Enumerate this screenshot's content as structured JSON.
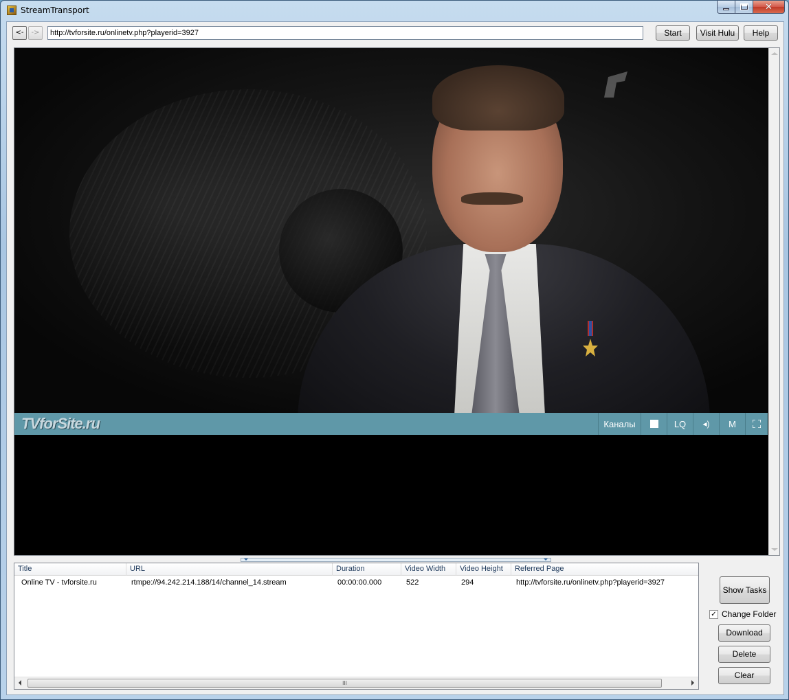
{
  "window": {
    "title": "StreamTransport"
  },
  "toolbar": {
    "back_label": "<-",
    "forward_label": "->",
    "url": "http://tvforsite.ru/onlinetv.php?playerid=3927",
    "start_label": "Start",
    "hulu_label": "Visit Hulu",
    "help_label": "Help"
  },
  "player": {
    "logo_text": "TVforSite.ru",
    "channels_label": "Каналы",
    "quality_label": "LQ",
    "mode_label": "M",
    "volume_icon": "speaker-icon",
    "fullscreen_icon": "fullscreen-icon",
    "bar_color": "#5f98a8"
  },
  "list": {
    "columns": [
      "Title",
      "URL",
      "Duration",
      "Video Width",
      "Video Height",
      "Referred Page"
    ],
    "rows": [
      {
        "title": "Online TV - tvforsite.ru",
        "url": "rtmpe://94.242.214.188/14/channel_14.stream",
        "duration": "00:00:00.000",
        "width": "522",
        "height": "294",
        "referred": "http://tvforsite.ru/onlinetv.php?playerid=3927"
      }
    ],
    "scroll_grip": "III"
  },
  "panel": {
    "show_tasks_label": "Show Tasks",
    "change_folder_label": "Change Folder",
    "change_folder_checked": true,
    "download_label": "Download",
    "delete_label": "Delete",
    "clear_label": "Clear"
  }
}
